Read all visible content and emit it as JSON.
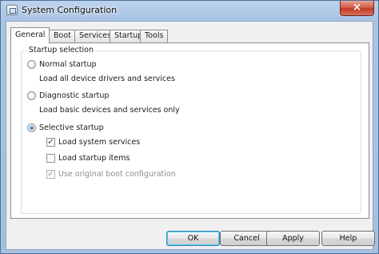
{
  "window": {
    "title": "System Configuration",
    "close_label": "×"
  },
  "tabs": [
    {
      "label": "General",
      "active": true
    },
    {
      "label": "Boot",
      "active": false
    },
    {
      "label": "Services",
      "active": false
    },
    {
      "label": "Startup",
      "active": false
    },
    {
      "label": "Tools",
      "active": false
    }
  ],
  "startup_selection": {
    "group_label": "Startup selection",
    "normal": {
      "label": "Normal startup",
      "description": "Load all device drivers and services",
      "selected": false
    },
    "diagnostic": {
      "label": "Diagnostic startup",
      "description": "Load basic devices and services only",
      "selected": false
    },
    "selective": {
      "label": "Selective startup",
      "selected": true
    },
    "options": [
      {
        "label": "Load system services",
        "checked": true,
        "enabled": true
      },
      {
        "label": "Load startup items",
        "checked": false,
        "enabled": true
      },
      {
        "label": "Use original boot configuration",
        "checked": true,
        "enabled": false
      }
    ],
    "check_mark": "✓"
  },
  "buttons": {
    "ok": "OK",
    "cancel": "Cancel",
    "apply": "Apply",
    "help": "Help"
  },
  "colors": {
    "titlebar": "#bcd3ec",
    "close_button": "#c23a23",
    "selected_radio": "#1f5ea5"
  }
}
